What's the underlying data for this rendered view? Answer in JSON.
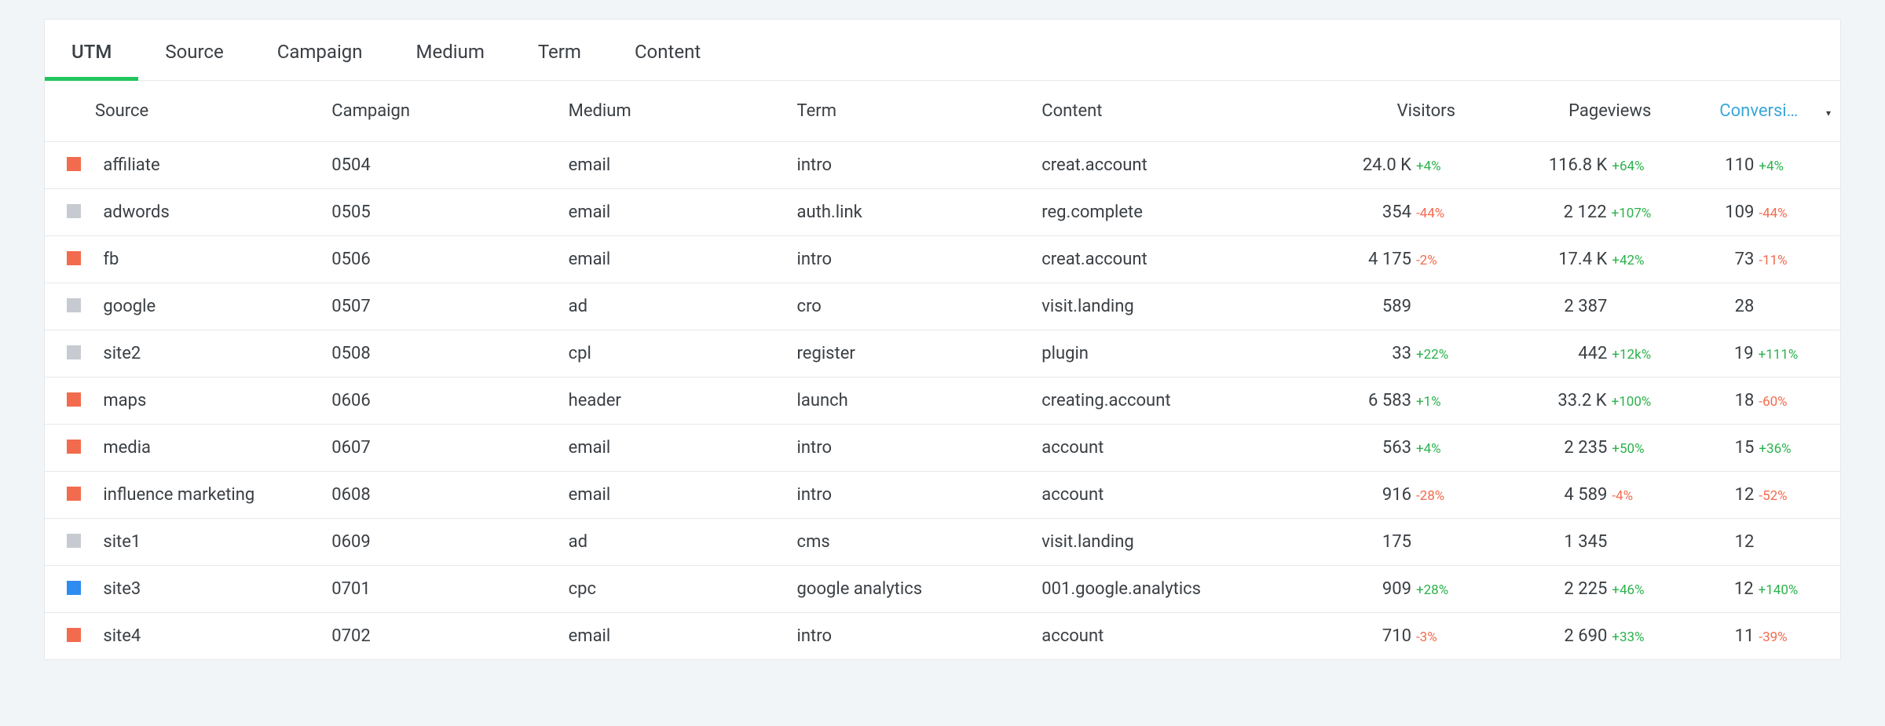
{
  "tabs": [
    {
      "label": "UTM",
      "active": true
    },
    {
      "label": "Source",
      "active": false
    },
    {
      "label": "Campaign",
      "active": false
    },
    {
      "label": "Medium",
      "active": false
    },
    {
      "label": "Term",
      "active": false
    },
    {
      "label": "Content",
      "active": false
    }
  ],
  "columns": {
    "source": "Source",
    "campaign": "Campaign",
    "medium": "Medium",
    "term": "Term",
    "content": "Content",
    "visitors": "Visitors",
    "pageviews": "Pageviews",
    "conversions": "Conversi…"
  },
  "sort_indicator": "▾",
  "rows": [
    {
      "color": "orange",
      "source": "affiliate",
      "campaign": "0504",
      "medium": "email",
      "term": "intro",
      "content": "creat.account",
      "visitors": {
        "value": "24.0 K",
        "delta": "+4%",
        "dir": "pos"
      },
      "pageviews": {
        "value": "116.8 K",
        "delta": "+64%",
        "dir": "pos"
      },
      "conversions": {
        "value": "110",
        "delta": "+4%",
        "dir": "pos"
      }
    },
    {
      "color": "grey",
      "source": "adwords",
      "campaign": "0505",
      "medium": "email",
      "term": "auth.link",
      "content": "reg.complete",
      "visitors": {
        "value": "354",
        "delta": "-44%",
        "dir": "neg"
      },
      "pageviews": {
        "value": "2 122",
        "delta": "+107%",
        "dir": "pos"
      },
      "conversions": {
        "value": "109",
        "delta": "-44%",
        "dir": "neg"
      }
    },
    {
      "color": "orange",
      "source": "fb",
      "campaign": "0506",
      "medium": "email",
      "term": "intro",
      "content": "creat.account",
      "visitors": {
        "value": "4 175",
        "delta": "-2%",
        "dir": "neg"
      },
      "pageviews": {
        "value": "17.4 K",
        "delta": "+42%",
        "dir": "pos"
      },
      "conversions": {
        "value": "73",
        "delta": "-11%",
        "dir": "neg"
      }
    },
    {
      "color": "grey",
      "source": "google",
      "campaign": "0507",
      "medium": "ad",
      "term": "cro",
      "content": "visit.landing",
      "visitors": {
        "value": "589",
        "delta": "",
        "dir": "none"
      },
      "pageviews": {
        "value": "2 387",
        "delta": "",
        "dir": "none"
      },
      "conversions": {
        "value": "28",
        "delta": "",
        "dir": "none"
      }
    },
    {
      "color": "grey",
      "source": "site2",
      "campaign": "0508",
      "medium": "cpl",
      "term": "register",
      "content": "plugin",
      "visitors": {
        "value": "33",
        "delta": "+22%",
        "dir": "pos"
      },
      "pageviews": {
        "value": "442",
        "delta": "+12k%",
        "dir": "pos"
      },
      "conversions": {
        "value": "19",
        "delta": "+111%",
        "dir": "pos"
      }
    },
    {
      "color": "orange",
      "source": "maps",
      "campaign": "0606",
      "medium": "header",
      "term": "launch",
      "content": "creating.account",
      "visitors": {
        "value": "6 583",
        "delta": "+1%",
        "dir": "pos"
      },
      "pageviews": {
        "value": "33.2 K",
        "delta": "+100%",
        "dir": "pos"
      },
      "conversions": {
        "value": "18",
        "delta": "-60%",
        "dir": "neg"
      }
    },
    {
      "color": "orange",
      "source": "media",
      "campaign": "0607",
      "medium": "email",
      "term": "intro",
      "content": "account",
      "visitors": {
        "value": "563",
        "delta": "+4%",
        "dir": "pos"
      },
      "pageviews": {
        "value": "2 235",
        "delta": "+50%",
        "dir": "pos"
      },
      "conversions": {
        "value": "15",
        "delta": "+36%",
        "dir": "pos"
      }
    },
    {
      "color": "orange",
      "source": "influence marketing",
      "campaign": "0608",
      "medium": "email",
      "term": "intro",
      "content": "account",
      "visitors": {
        "value": "916",
        "delta": "-28%",
        "dir": "neg"
      },
      "pageviews": {
        "value": "4 589",
        "delta": "-4%",
        "dir": "neg"
      },
      "conversions": {
        "value": "12",
        "delta": "-52%",
        "dir": "neg"
      }
    },
    {
      "color": "grey",
      "source": "site1",
      "campaign": "0609",
      "medium": "ad",
      "term": "cms",
      "content": "visit.landing",
      "visitors": {
        "value": "175",
        "delta": "",
        "dir": "none"
      },
      "pageviews": {
        "value": "1 345",
        "delta": "",
        "dir": "none"
      },
      "conversions": {
        "value": "12",
        "delta": "",
        "dir": "none"
      }
    },
    {
      "color": "blue",
      "source": "site3",
      "campaign": "0701",
      "medium": "cpc",
      "term": "google analytics",
      "content": "001.google.analytics",
      "visitors": {
        "value": "909",
        "delta": "+28%",
        "dir": "pos"
      },
      "pageviews": {
        "value": "2 225",
        "delta": "+46%",
        "dir": "pos"
      },
      "conversions": {
        "value": "12",
        "delta": "+140%",
        "dir": "pos"
      }
    },
    {
      "color": "orange",
      "source": "site4",
      "campaign": "0702",
      "medium": "email",
      "term": "intro",
      "content": "account",
      "visitors": {
        "value": "710",
        "delta": "-3%",
        "dir": "neg"
      },
      "pageviews": {
        "value": "2 690",
        "delta": "+33%",
        "dir": "pos"
      },
      "conversions": {
        "value": "11",
        "delta": "-39%",
        "dir": "neg"
      }
    }
  ]
}
